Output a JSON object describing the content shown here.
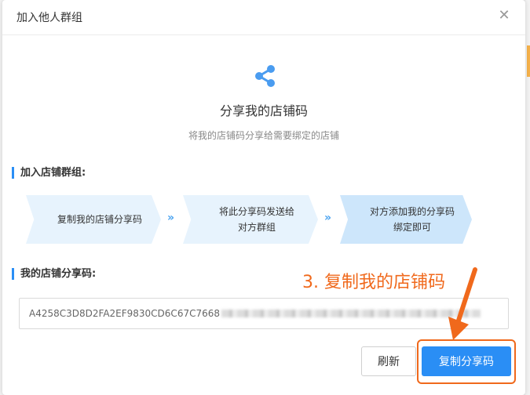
{
  "dialog": {
    "title": "加入他人群组",
    "close_icon": "close-icon"
  },
  "hero": {
    "icon": "share-icon",
    "title": "分享我的店铺码",
    "subtitle": "将我的店铺码分享给需要绑定的店铺"
  },
  "join_section": {
    "label": "加入店铺群组:",
    "steps": [
      {
        "line1": "复制我的店铺分享码",
        "line2": ""
      },
      {
        "line1": "将此分享码发送给",
        "line2": "对方群组"
      },
      {
        "line1": "对方添加我的分享码",
        "line2": "绑定即可"
      }
    ],
    "step_chevron": "»"
  },
  "code_section": {
    "label": "我的店铺分享码:",
    "code_value": "A4258C3D8D2FA2EF9830CD6C67C7668"
  },
  "buttons": {
    "refresh": "刷新",
    "copy": "复制分享码"
  },
  "annotation": {
    "text": "3. 复制我的店铺码",
    "color": "#f0691c"
  },
  "colors": {
    "accent": "#2a8ef5",
    "step_bg": "#e7f3fd",
    "step_active_bg": "#cde6fb"
  }
}
